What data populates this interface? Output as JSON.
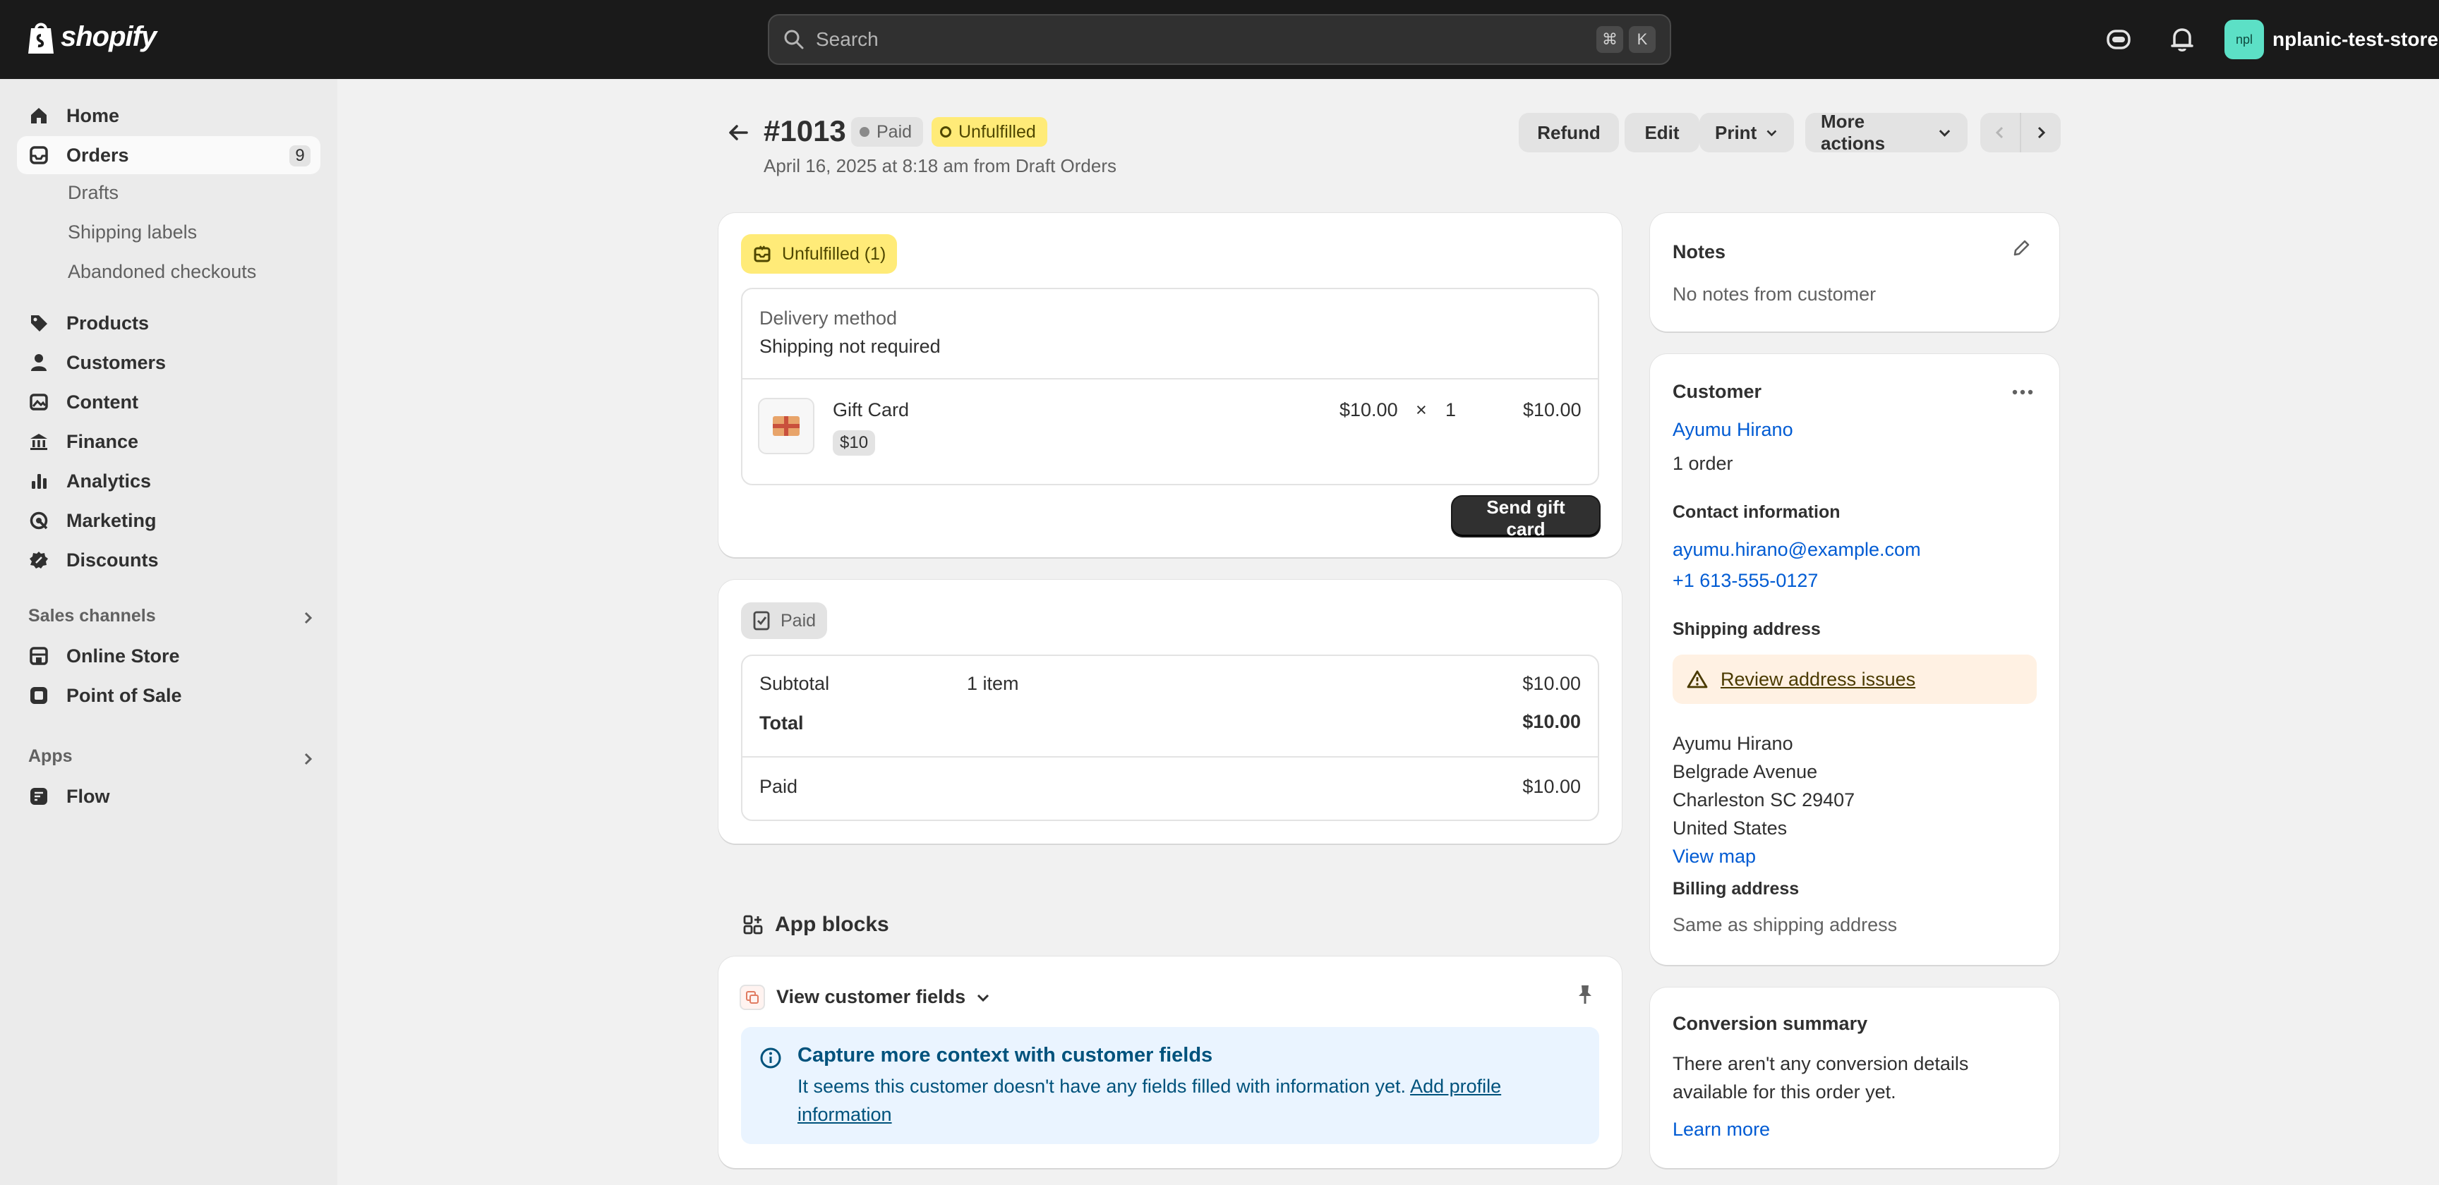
{
  "topbar": {
    "logo_text": "shopify",
    "search_placeholder": "Search",
    "shortcut_keys": [
      "⌘",
      "K"
    ],
    "store_initials": "npl",
    "store_name": "nplanic-test-store"
  },
  "sidebar": {
    "items": [
      {
        "label": "Home",
        "icon": "home-icon"
      },
      {
        "label": "Orders",
        "icon": "orders-icon",
        "badge": "9",
        "active": true
      },
      {
        "label": "Products",
        "icon": "tag-icon"
      },
      {
        "label": "Customers",
        "icon": "person-icon"
      },
      {
        "label": "Content",
        "icon": "content-icon"
      },
      {
        "label": "Finance",
        "icon": "bank-icon"
      },
      {
        "label": "Analytics",
        "icon": "bar-chart-icon"
      },
      {
        "label": "Marketing",
        "icon": "target-icon"
      },
      {
        "label": "Discounts",
        "icon": "discount-icon"
      }
    ],
    "order_subitems": [
      "Drafts",
      "Shipping labels",
      "Abandoned checkouts"
    ],
    "sales_channels_label": "Sales channels",
    "sales_channels": [
      {
        "label": "Online Store",
        "icon": "store-icon"
      },
      {
        "label": "Point of Sale",
        "icon": "pos-icon"
      }
    ],
    "apps_label": "Apps",
    "apps": [
      {
        "label": "Flow",
        "icon": "flow-icon"
      }
    ]
  },
  "order": {
    "number": "#1013",
    "payment_badge": "Paid",
    "fulfillment_badge": "Unfulfilled",
    "meta": "April 16, 2025 at 8:18 am from Draft Orders",
    "actions": {
      "refund": "Refund",
      "edit": "Edit",
      "print": "Print",
      "more": "More actions"
    }
  },
  "fulfillment": {
    "status": "Unfulfilled (1)",
    "delivery_label": "Delivery method",
    "delivery_value": "Shipping not required",
    "item_name": "Gift Card",
    "item_variant": "$10",
    "item_price": "$10.00",
    "item_times": "×",
    "item_qty": "1",
    "item_total": "$10.00",
    "send_button": "Send gift card"
  },
  "payment": {
    "status": "Paid",
    "subtotal_label": "Subtotal",
    "subtotal_items": "1 item",
    "subtotal_value": "$10.00",
    "total_label": "Total",
    "total_value": "$10.00",
    "paid_label": "Paid",
    "paid_value": "$10.00"
  },
  "app_blocks": {
    "title": "App blocks",
    "dropdown_label": "View customer fields",
    "info_title": "Capture more context with customer fields",
    "info_text": "It seems this customer doesn't have any fields filled with information yet.",
    "info_link_line1": "Add profile",
    "info_link_line2": "information"
  },
  "notes": {
    "title": "Notes",
    "text": "No notes from customer"
  },
  "customer": {
    "title": "Customer",
    "name": "Ayumu Hirano",
    "orders": "1 order",
    "contact_title": "Contact information",
    "email": "ayumu.hirano@example.com",
    "phone": "+1 613-555-0127",
    "shipping_title": "Shipping address",
    "warning": "Review address issues",
    "address_lines": [
      "Ayumu Hirano",
      "Belgrade Avenue",
      "Charleston SC 29407",
      "United States"
    ],
    "view_map": "View map",
    "billing_title": "Billing address",
    "billing_text": "Same as shipping address"
  },
  "conversion": {
    "title": "Conversion summary",
    "text_line1": "There aren't any conversion details",
    "text_line2": "available for this order yet.",
    "link": "Learn more"
  },
  "colors": {
    "topbar": "#1a1a1a",
    "link": "#005bd3",
    "unfulfilled": "#ffeb78",
    "warning_bg": "#fff1e3",
    "info_bg": "#eaf4ff"
  }
}
